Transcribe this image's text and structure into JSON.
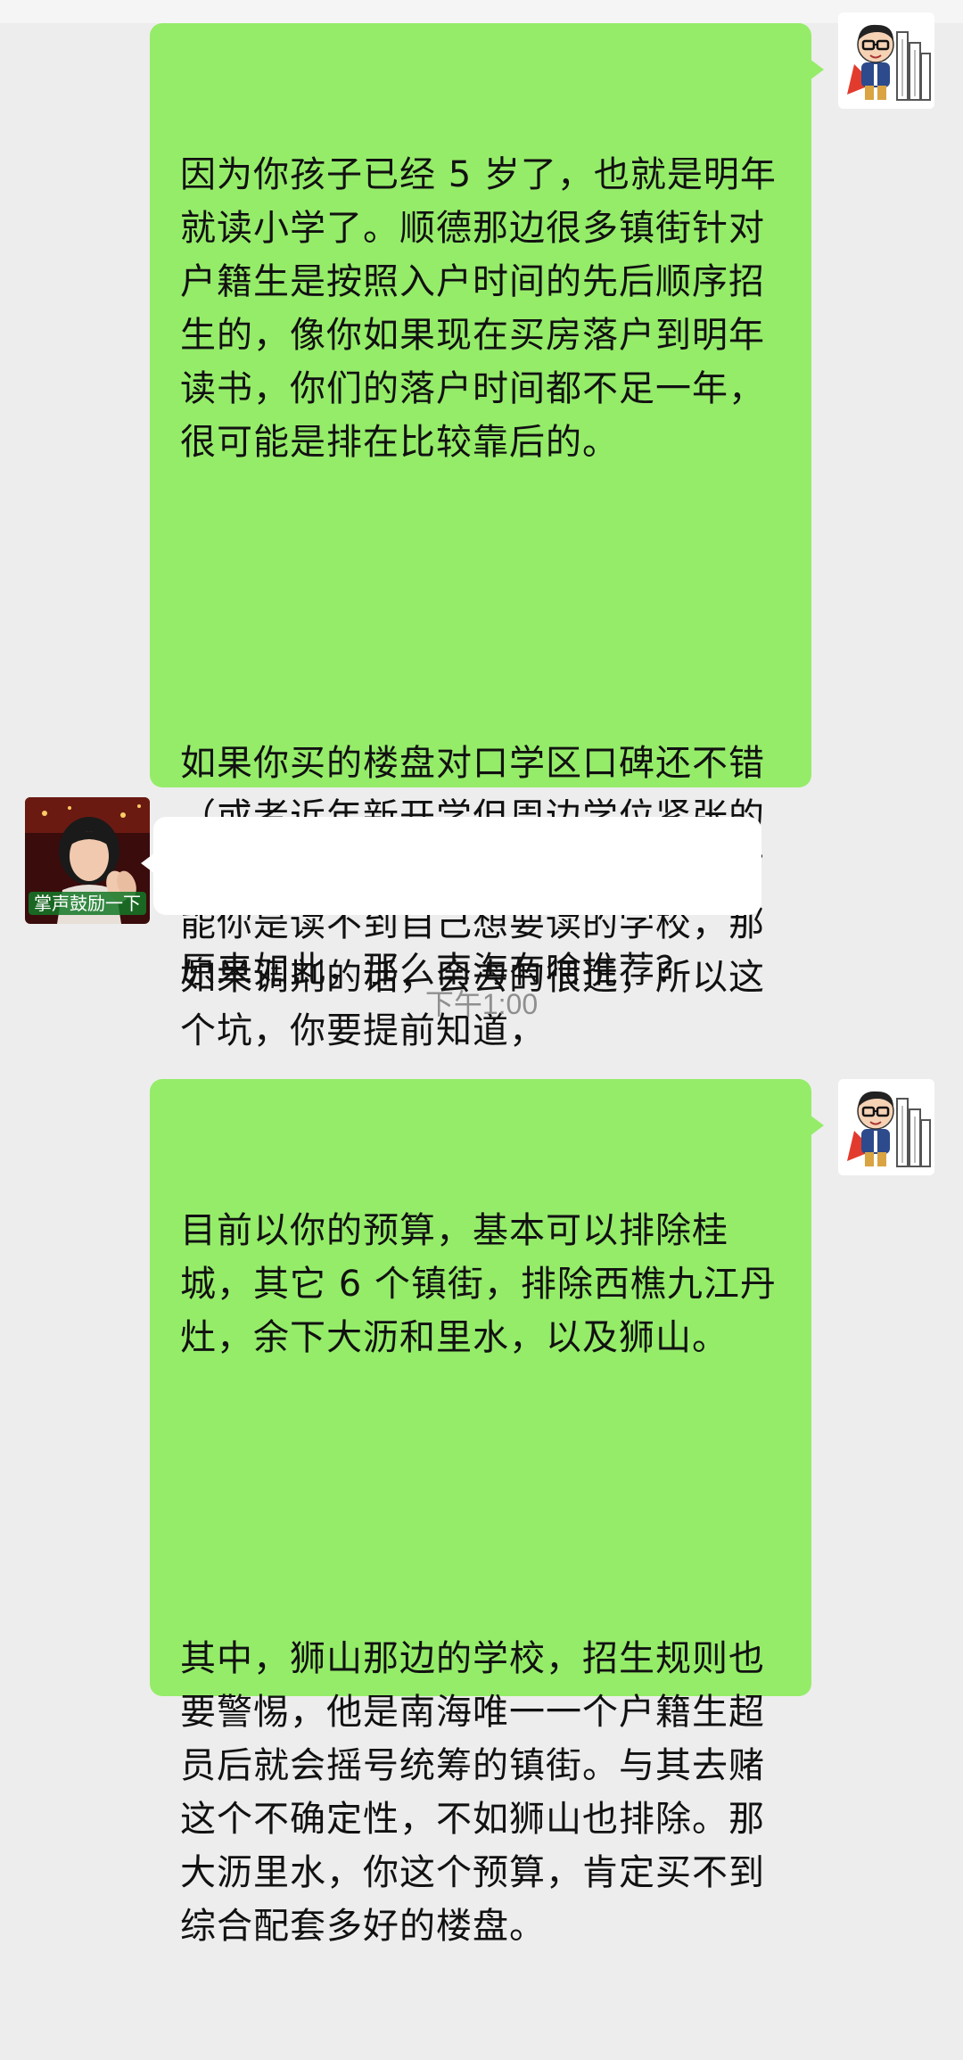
{
  "chat": {
    "messages": [
      {
        "id": "m1",
        "direction": "out",
        "paragraphs": [
          "因为你孩子已经 5 岁了，也就是明年就读小学了。顺德那边很多镇街针对户籍生是按照入户时间的先后顺序招生的，像你如果现在买房落户到明年读书，你们的落户时间都不足一年，很可能是排在比较靠后的。",
          "如果你买的楼盘对口学区口碑还不错（或者近年新开学但周边学位紧张的区域，比如顺德陈村西部）那么有可能你是读不到自己想要读的学校，那如果调剂的话，会去的很远，所以这个坑，你要提前知道，"
        ]
      },
      {
        "id": "m2",
        "direction": "in",
        "text": "原来如此，那么南海有啥推荐？",
        "avatar_caption": "掌声鼓励一下"
      },
      {
        "id": "m3",
        "direction": "out",
        "paragraphs": [
          "目前以你的预算，基本可以排除桂城，其它 6 个镇街，排除西樵九江丹灶，余下大沥和里水，以及狮山。",
          "其中，狮山那边的学校，招生规则也要警惕，他是南海唯一一个户籍生超员后就会摇号统筹的镇街。与其去赌这个不确定性，不如狮山也排除。那大沥里水，你这个预算，肯定买不到综合配套多好的楼盘。"
        ]
      }
    ],
    "timestamp": "下午1:00"
  },
  "avatars": {
    "agent": "cartoon-man-glasses-buildings-icon",
    "user": "woman-clapping-sticker"
  },
  "colors": {
    "background": "#ededed",
    "outgoing_bubble": "#95ec69",
    "incoming_bubble": "#ffffff",
    "timestamp_text": "#8f8f8f"
  }
}
